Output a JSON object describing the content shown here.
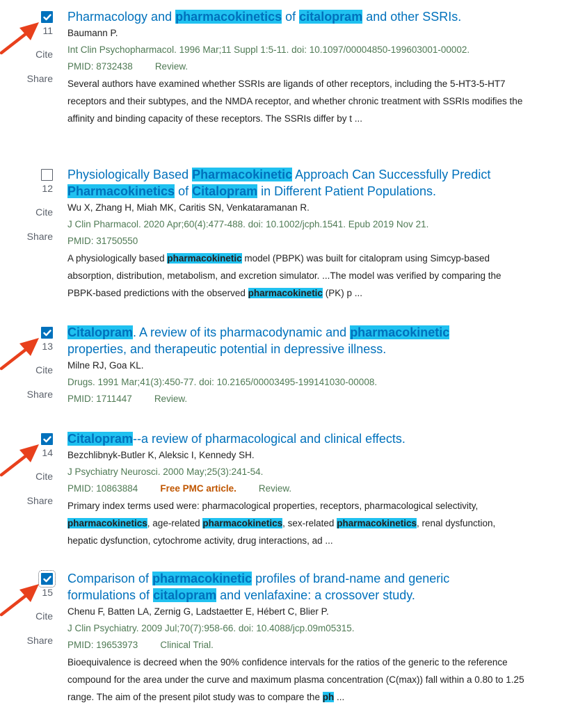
{
  "accent_color": "#0071bc",
  "highlight_color": "#20c1f0",
  "citation_color": "#4f7a54",
  "free_pmc_color": "#c05600",
  "annotation_arrow_color": "#e8401c",
  "results": [
    {
      "number": "11",
      "checked": true,
      "arrow": true,
      "title_parts": [
        {
          "t": "Pharmacology and ",
          "h": false
        },
        {
          "t": "pharmacokinetics",
          "h": true
        },
        {
          "t": " of ",
          "h": false
        },
        {
          "t": "citalopram",
          "h": true
        },
        {
          "t": " and other SSRIs.",
          "h": false
        }
      ],
      "authors": "Baumann P.",
      "citation": "Int Clin Psychopharmacol. 1996 Mar;11 Suppl 1:5-11. doi: 10.1097/00004850-199603001-00002.",
      "pmid": "PMID: 8732438",
      "free_pmc": "",
      "pub_type": "Review.",
      "snippet_parts": [
        {
          "t": "Several authors have examined whether SSRIs are ligands of other receptors, including the 5-HT3-5-HT7 receptors and their subtypes, and the NMDA receptor, and whether chronic treatment with SSRIs modifies the affinity and binding capacity of these receptors. The SSRIs differ by t ...",
          "h": false
        }
      ]
    },
    {
      "number": "12",
      "checked": false,
      "arrow": false,
      "title_parts": [
        {
          "t": "Physiologically Based ",
          "h": false
        },
        {
          "t": "Pharmacokinetic",
          "h": true
        },
        {
          "t": " Approach Can Successfully Predict ",
          "h": false
        },
        {
          "t": "Pharmacokinetics",
          "h": true
        },
        {
          "t": " of ",
          "h": false
        },
        {
          "t": "Citalopram",
          "h": true
        },
        {
          "t": " in Different Patient Populations.",
          "h": false
        }
      ],
      "authors": "Wu X, Zhang H, Miah MK, Caritis SN, Venkataramanan R.",
      "citation": "J Clin Pharmacol. 2020 Apr;60(4):477-488. doi: 10.1002/jcph.1541. Epub 2019 Nov 21.",
      "pmid": "PMID: 31750550",
      "free_pmc": "",
      "pub_type": "",
      "snippet_parts": [
        {
          "t": "A physiologically based ",
          "h": false
        },
        {
          "t": "pharmacokinetic",
          "h": true
        },
        {
          "t": " model (PBPK) was built for citalopram using Simcyp-based absorption, distribution, metabolism, and excretion simulator. ...The model was verified by comparing the PBPK-based predictions with the observed ",
          "h": false
        },
        {
          "t": "pharmacokinetic",
          "h": true
        },
        {
          "t": " (PK) p ...",
          "h": false
        }
      ]
    },
    {
      "number": "13",
      "checked": true,
      "arrow": true,
      "title_parts": [
        {
          "t": "Citalopram",
          "h": true
        },
        {
          "t": ". A review of its pharmacodynamic and ",
          "h": false
        },
        {
          "t": "pharmacokinetic",
          "h": true
        },
        {
          "t": " properties, and therapeutic potential in depressive illness.",
          "h": false
        }
      ],
      "authors": "Milne RJ, Goa KL.",
      "citation": "Drugs. 1991 Mar;41(3):450-77. doi: 10.2165/00003495-199141030-00008.",
      "pmid": "PMID: 1711447",
      "free_pmc": "",
      "pub_type": "Review.",
      "snippet_parts": []
    },
    {
      "number": "14",
      "checked": true,
      "arrow": true,
      "title_parts": [
        {
          "t": "Citalopram",
          "h": true
        },
        {
          "t": "--a review of pharmacological and clinical effects.",
          "h": false
        }
      ],
      "authors": "Bezchlibnyk-Butler K, Aleksic I, Kennedy SH.",
      "citation": "J Psychiatry Neurosci. 2000 May;25(3):241-54.",
      "pmid": "PMID: 10863884",
      "free_pmc": "Free PMC article.",
      "pub_type": "Review.",
      "snippet_parts": [
        {
          "t": "Primary index terms used were: pharmacological properties, receptors, pharmacological selectivity, ",
          "h": false
        },
        {
          "t": "pharmacokinetics",
          "h": true
        },
        {
          "t": ", age-related ",
          "h": false
        },
        {
          "t": "pharmacokinetics",
          "h": true
        },
        {
          "t": ", sex-related ",
          "h": false
        },
        {
          "t": "pharmacokinetics",
          "h": true
        },
        {
          "t": ", renal dysfunction, hepatic dysfunction, cytochrome activity, drug interactions, ad ...",
          "h": false
        }
      ]
    },
    {
      "number": "15",
      "checked": true,
      "focused": true,
      "arrow": true,
      "title_parts": [
        {
          "t": "Comparison of ",
          "h": false
        },
        {
          "t": "pharmacokinetic",
          "h": true
        },
        {
          "t": " profiles of brand-name and generic formulations of ",
          "h": false
        },
        {
          "t": "citalopram",
          "h": true
        },
        {
          "t": " and venlafaxine: a crossover study.",
          "h": false
        }
      ],
      "authors": "Chenu F, Batten LA, Zernig G, Ladstaetter E, Hébert C, Blier P.",
      "citation": "J Clin Psychiatry. 2009 Jul;70(7):958-66. doi: 10.4088/jcp.09m05315.",
      "pmid": "PMID: 19653973",
      "free_pmc": "",
      "pub_type": "Clinical Trial.",
      "snippet_parts": [
        {
          "t": "Bioequivalence is decreed when the 90% confidence intervals for the ratios of the generic to the reference compound for the area under the curve and maximum plasma concentration (C(max)) fall within a 0.80 to 1.25 range. The aim of the present pilot study was to compare the ",
          "h": false
        },
        {
          "t": "ph",
          "h": true
        },
        {
          "t": " ...",
          "h": false
        }
      ]
    }
  ],
  "labels": {
    "cite": "Cite",
    "share": "Share"
  }
}
